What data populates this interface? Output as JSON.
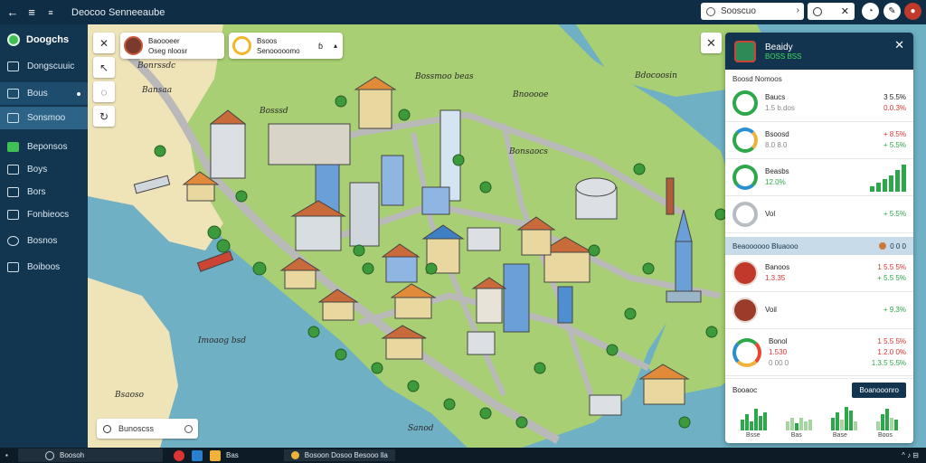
{
  "topbar": {
    "back_icon": "arrow-left-icon",
    "menu_icon": "hamburger-icon",
    "app_short": "≡",
    "title": "Deocoo Senneeaube",
    "search_placeholder": "Sooscuo",
    "search_short": "O",
    "right_icons": [
      "bell-icon",
      "chat-icon",
      "avatar-icon"
    ]
  },
  "sidebar": {
    "brand": "Doogchs",
    "items": [
      {
        "label": "Dongscuuic",
        "icon": "map-icon"
      },
      {
        "label": "Bous",
        "icon": "car-icon"
      },
      {
        "label": "Sonsmoo",
        "icon": "leaf-icon"
      },
      {
        "label": "Beponsos",
        "icon": "chart-icon"
      },
      {
        "label": "Boys",
        "icon": "mail-icon"
      },
      {
        "label": "Bors",
        "icon": "image-icon"
      },
      {
        "label": "Fonbieocs",
        "icon": "file-icon"
      },
      {
        "label": "Bosnos",
        "icon": "settings-icon"
      },
      {
        "label": "Boiboos",
        "icon": "card-icon"
      }
    ]
  },
  "map": {
    "user_card": {
      "name": "Baoooeer",
      "sub": "Oseg nloosr"
    },
    "weather_card": {
      "line1": "Bsoos",
      "line2": "Senooooomo",
      "right": "ɓ"
    },
    "labels": {
      "top_left": "Bosssd",
      "mid_left": "Bonrssdc",
      "top_right": "Bossmoo beas",
      "top_right2": "Bdocoosin",
      "bay1": "Bnooooe",
      "bay2": "Bansaa",
      "water": "Imoaog bsd",
      "water2": "Bsaoso",
      "mid_right": "Bonsaocs",
      "bottom": "Sanod"
    },
    "search_placeholder": "Bunoscss"
  },
  "panel": {
    "title": "Beaidy",
    "subtitle": "BOSS BSS",
    "section_label": "Boosd Nomoos",
    "rows": [
      {
        "name": "Baucs",
        "sub": "1.5 b.dos",
        "v1": "3 5.5%",
        "v2": "0.0.3%"
      },
      {
        "name": "Bsoosd",
        "sub": "8.0 8.0",
        "v1": "+ 8.5%",
        "v2": "+ 5.5%"
      },
      {
        "name": "Beasbs",
        "sub": "12.0%",
        "v1": "",
        "v2": ""
      },
      {
        "name": "Vol",
        "sub": "",
        "v1": "+ 5.5%",
        "v2": ""
      }
    ],
    "mid_section": {
      "label": "Beaoooooo Bluaooo",
      "right": "0 0 0"
    },
    "rows2": [
      {
        "name": "Banoos",
        "sub": "1.3.35",
        "v1": "1 5.5 5%",
        "v2": "+ 5.5 5%"
      },
      {
        "name": "Voil",
        "sub": "",
        "v1": "+ 9.3%",
        "v2": ""
      },
      {
        "name": "Bonol",
        "sub": "1.530",
        "sub2": "0 00 0",
        "v1": "1 5.5 5%",
        "v2": "1.2.0 0%",
        "v3": "1.3.5 5.5%"
      }
    ],
    "bottom": {
      "label": "Booaoc",
      "button": "Boanooonro",
      "labels": [
        "Bsse",
        "Bas",
        "Base",
        "Boos"
      ]
    }
  },
  "taskbar": {
    "search": "Boosoh",
    "app_label": "Bas",
    "window_label": "Bosoon Dosoo Besooo lla",
    "sys": "^ ♪ ⊟"
  },
  "colors": {
    "sidebar": "#123650",
    "accent_green": "#2ca84a",
    "water": "#6fb0c4",
    "land": "#9fcb6b"
  }
}
